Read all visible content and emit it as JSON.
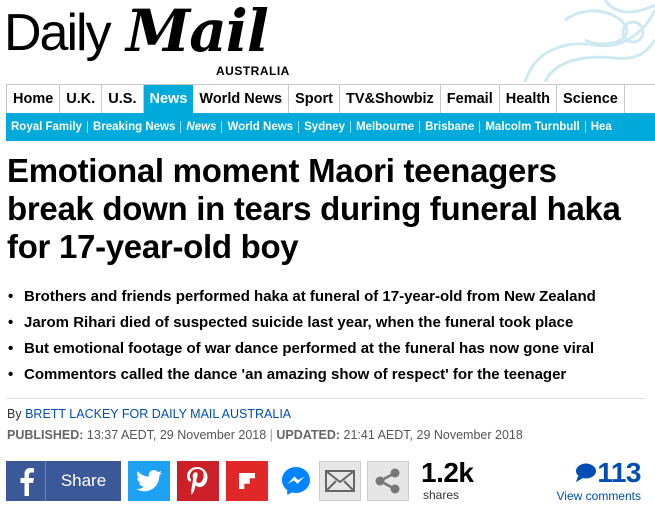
{
  "masthead": {
    "logo_part1": "Daily",
    "logo_part2": "Mail",
    "edition": "AUSTRALIA"
  },
  "nav_primary": {
    "items": [
      "Home",
      "U.K.",
      "U.S.",
      "News",
      "World News",
      "Sport",
      "TV&Showbiz",
      "Femail",
      "Health",
      "Science"
    ],
    "active": "News"
  },
  "nav_secondary": {
    "items": [
      "Royal Family",
      "Breaking News",
      "News",
      "World News",
      "Sydney",
      "Melbourne",
      "Brisbane",
      "Malcolm Turnbull",
      "Hea"
    ],
    "current": "News"
  },
  "article": {
    "headline": "Emotional moment Maori teenagers break down in tears during funeral haka for 17-year-old boy",
    "bullets": [
      "Brothers and friends performed haka at funeral of 17-year-old from New Zealand",
      "Jarom Rihari died of suspected suicide last year, when the funeral took place",
      "But emotional footage of war dance performed at the funeral has now gone viral",
      "Commentors called the dance 'an amazing show of respect' for the teenager"
    ],
    "byline_prefix": "By",
    "author": "BRETT LACKEY FOR DAILY MAIL AUSTRALIA",
    "published_label": "PUBLISHED:",
    "published": "13:37 AEDT, 29 November 2018",
    "updated_label": "UPDATED:",
    "updated": "21:41 AEDT, 29 November 2018"
  },
  "share": {
    "facebook_label": "Share",
    "share_count": "1.2k",
    "share_count_label": "shares",
    "comment_count": "113",
    "comment_label": "View comments",
    "icons": [
      "facebook-icon",
      "twitter-icon",
      "pinterest-icon",
      "flipboard-icon",
      "messenger-icon",
      "email-icon",
      "share-icon",
      "comment-bubble-icon"
    ]
  },
  "colors": {
    "accent": "#00aadb",
    "facebook": "#3b5998",
    "twitter": "#1da1f2",
    "pinterest": "#cb2027",
    "flipboard": "#e12828",
    "messenger": "#0084ff",
    "link": "#004db3"
  }
}
